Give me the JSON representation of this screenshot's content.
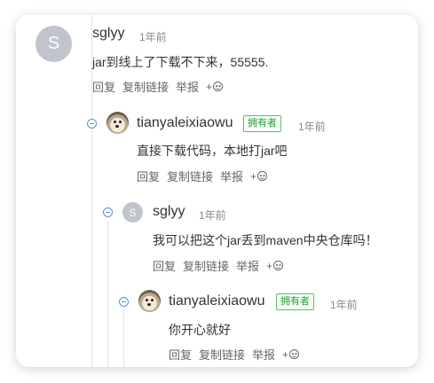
{
  "comments": [
    {
      "avatar_letter": "S",
      "username": "sglyy",
      "time": "1年前",
      "content": "jar到线上了下载不下来，55555.",
      "actions": {
        "reply": "回复",
        "copy_link": "复制链接",
        "report": "举报",
        "emoji_plus": "+"
      }
    },
    {
      "username": "tianyaleixiaowu",
      "badge": "拥有者",
      "time": "1年前",
      "content": "直接下载代码，本地打jar吧",
      "actions": {
        "reply": "回复",
        "copy_link": "复制链接",
        "report": "举报",
        "emoji_plus": "+"
      }
    },
    {
      "avatar_letter": "S",
      "username": "sglyy",
      "time": "1年前",
      "content": "我可以把这个jar丢到maven中央仓库吗！",
      "actions": {
        "reply": "回复",
        "copy_link": "复制链接",
        "report": "举报",
        "emoji_plus": "+"
      }
    },
    {
      "username": "tianyaleixiaowu",
      "badge": "拥有者",
      "time": "1年前",
      "content": "你开心就好",
      "actions": {
        "reply": "回复",
        "copy_link": "复制链接",
        "report": "举报",
        "emoji_plus": "+"
      }
    }
  ],
  "colors": {
    "badge_green": "#26a03a",
    "collapse_blue": "#5a8fd8",
    "avatar_gray": "#c0c4cc"
  },
  "icons": {
    "collapse": "collapse-minus-icon",
    "emoji": "smiley-icon"
  }
}
